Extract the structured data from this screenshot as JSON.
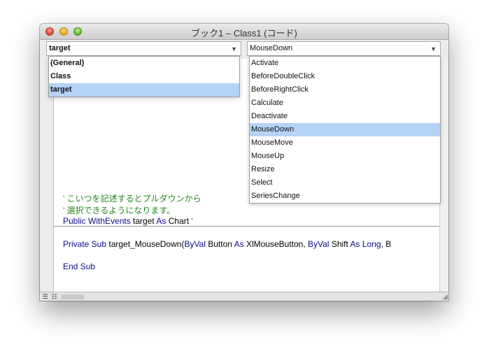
{
  "window": {
    "title": "ブック1 – Class1 (コード)"
  },
  "object_combo": {
    "value": "target"
  },
  "procedure_combo": {
    "value": "MouseDown"
  },
  "object_dropdown": {
    "items": [
      {
        "label": "(General)"
      },
      {
        "label": "Class"
      },
      {
        "label": "target"
      }
    ],
    "selected": "target"
  },
  "procedure_dropdown": {
    "items": [
      {
        "label": "Activate"
      },
      {
        "label": "BeforeDoubleClick"
      },
      {
        "label": "BeforeRightClick"
      },
      {
        "label": "Calculate"
      },
      {
        "label": "Deactivate"
      },
      {
        "label": "MouseDown"
      },
      {
        "label": "MouseMove"
      },
      {
        "label": "MouseUp"
      },
      {
        "label": "Resize"
      },
      {
        "label": "Select"
      },
      {
        "label": "SeriesChange"
      }
    ],
    "selected": "MouseDown"
  },
  "code": {
    "comment1": "' こいつを記述するとプルダウンから",
    "comment2": "' 選択できるようになります。",
    "declaration": {
      "kw1": "Public WithEvents",
      "name": " target ",
      "kw2": "As",
      "type": " Chart ",
      "tail": "'"
    },
    "sub": {
      "kw1": "Private Sub",
      "name": " target_MouseDown(",
      "kw2": "ByVal",
      "p1": " Button ",
      "kw3": "As",
      "p2": " XlMouseButton, ",
      "kw4": "ByVal",
      "p3": " Shift ",
      "kw5": "As",
      "kw6": " Long",
      "p4": ", B"
    },
    "end": "End Sub"
  },
  "colors": {
    "keyword": "#0b0b8a",
    "comment": "#238a1c",
    "selection": "#b6d3f6"
  },
  "icons": [
    "close-button",
    "minimize-button",
    "zoom-button",
    "dropdown-arrow-icon",
    "procedure-view-icon",
    "full-module-view-icon",
    "resize-grip-icon"
  ]
}
